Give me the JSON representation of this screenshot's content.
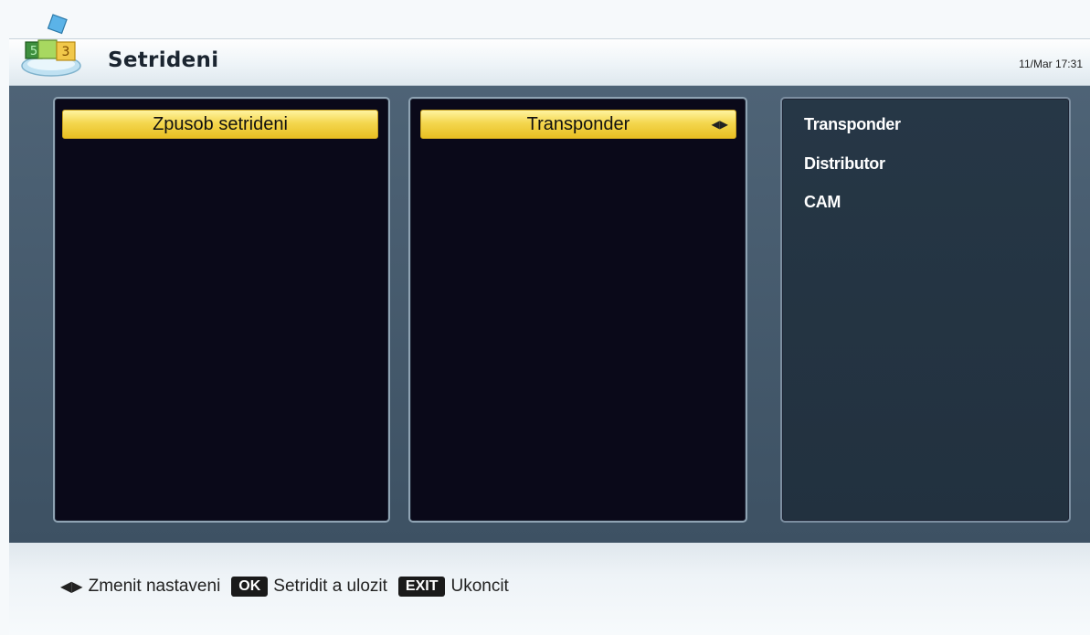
{
  "header": {
    "title": "Setrideni",
    "clock": "11/Mar 17:31",
    "logo_icon": "menu-cubes-icon",
    "logo_digits": [
      "5",
      "3"
    ]
  },
  "sort_menu": {
    "label": "Zpusob setrideni",
    "current_value": "Transponder",
    "options": [
      "Transponder",
      "Distributor",
      "CAM"
    ]
  },
  "footer": {
    "change_label": "Zmenit nastaveni",
    "ok_key": "OK",
    "ok_label": "Setridit a ulozit",
    "exit_key": "EXIT",
    "exit_label": "Ukoncit"
  },
  "colors": {
    "highlight": "#f4d74f",
    "panel_bg": "#0a0919",
    "frame_bg": "#4e6376"
  }
}
